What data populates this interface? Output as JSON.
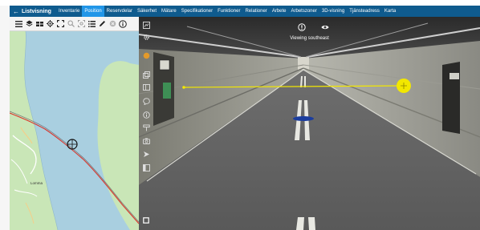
{
  "nav": {
    "back_label": "Listvisning",
    "tabs": [
      {
        "label": "Inventarie"
      },
      {
        "label": "Position"
      },
      {
        "label": "Reservdelar"
      },
      {
        "label": "Säkerhet"
      },
      {
        "label": "Mätare"
      },
      {
        "label": "Specifikationer"
      },
      {
        "label": "Funktioner"
      },
      {
        "label": "Relationer"
      },
      {
        "label": "Arbete"
      },
      {
        "label": "Arbetszoner"
      },
      {
        "label": "3D-visning"
      },
      {
        "label": "Tjänsteadress"
      },
      {
        "label": "Karta"
      }
    ],
    "active_tab": "Position"
  },
  "map": {
    "place_label": "Lomma"
  },
  "viewer": {
    "heading_text": "Viewing southeast"
  },
  "colors": {
    "nav_bar": "#0f5b8e",
    "active_tab": "#2196e8",
    "water": "#a9cfe0",
    "land": "#c9e6b7",
    "route": "#d9342b",
    "measure_line": "#f2e700"
  }
}
